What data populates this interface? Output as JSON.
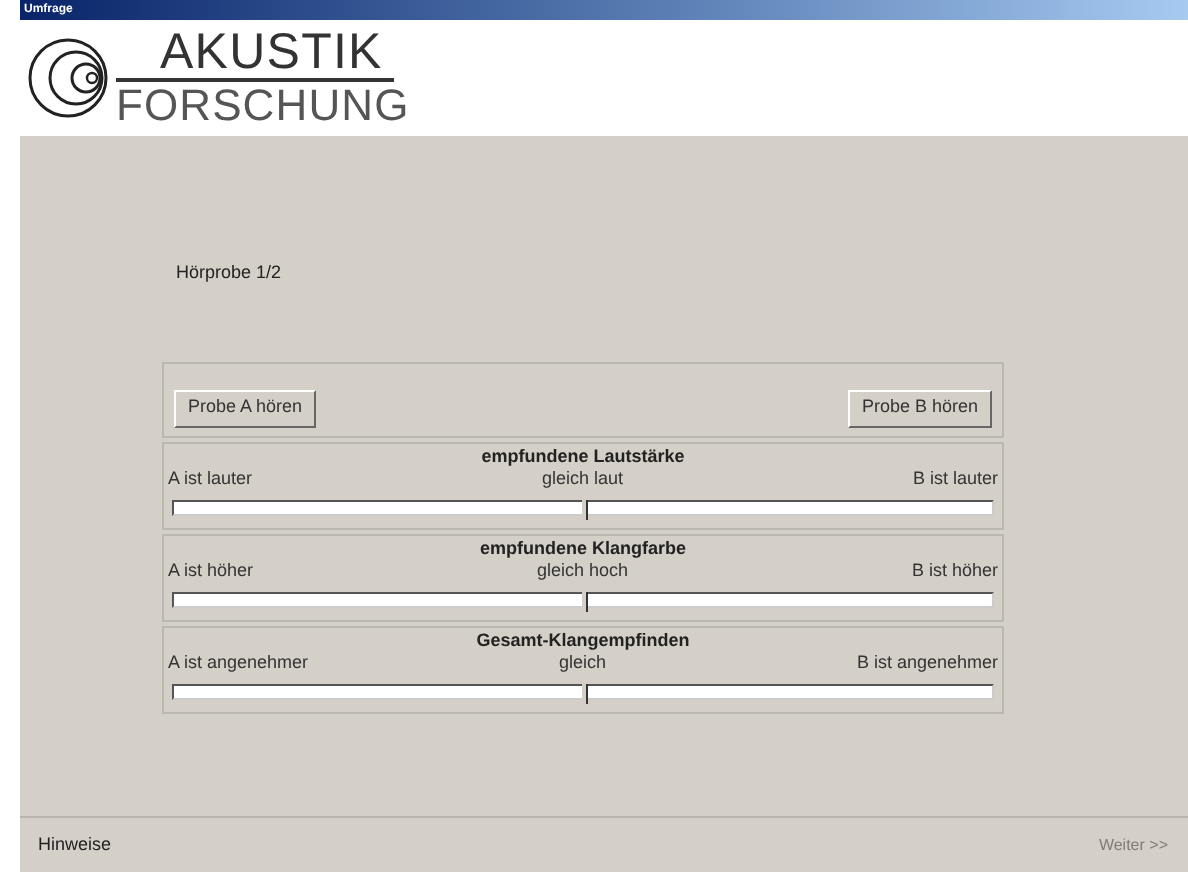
{
  "window": {
    "title": "Umfrage"
  },
  "logo": {
    "line1": "AKUSTIK",
    "line2": "FORSCHUNG"
  },
  "heading": "Hörprobe 1/2",
  "buttons": [
    "Probe A hören",
    "Probe B hören"
  ],
  "scales": [
    {
      "title": "empfundene Lautstärke",
      "left": "A ist lauter",
      "center": "gleich laut",
      "right": "B ist lauter",
      "level": 0.5
    },
    {
      "title": "empfundene Klangfarbe",
      "left": "A ist höher",
      "center": "gleich hoch",
      "right": "B ist höher",
      "level": 0.5
    },
    {
      "title": "Gesamt-Klangempfinden",
      "left": "A ist angenehmer",
      "center": "gleich",
      "right": "B ist angenehmer",
      "level": 0.5
    }
  ],
  "footer": {
    "hint_button": {
      "label": "Hinweise",
      "disabled": false
    },
    "next_button": {
      "label": "Weiter >>",
      "disabled": true
    }
  }
}
